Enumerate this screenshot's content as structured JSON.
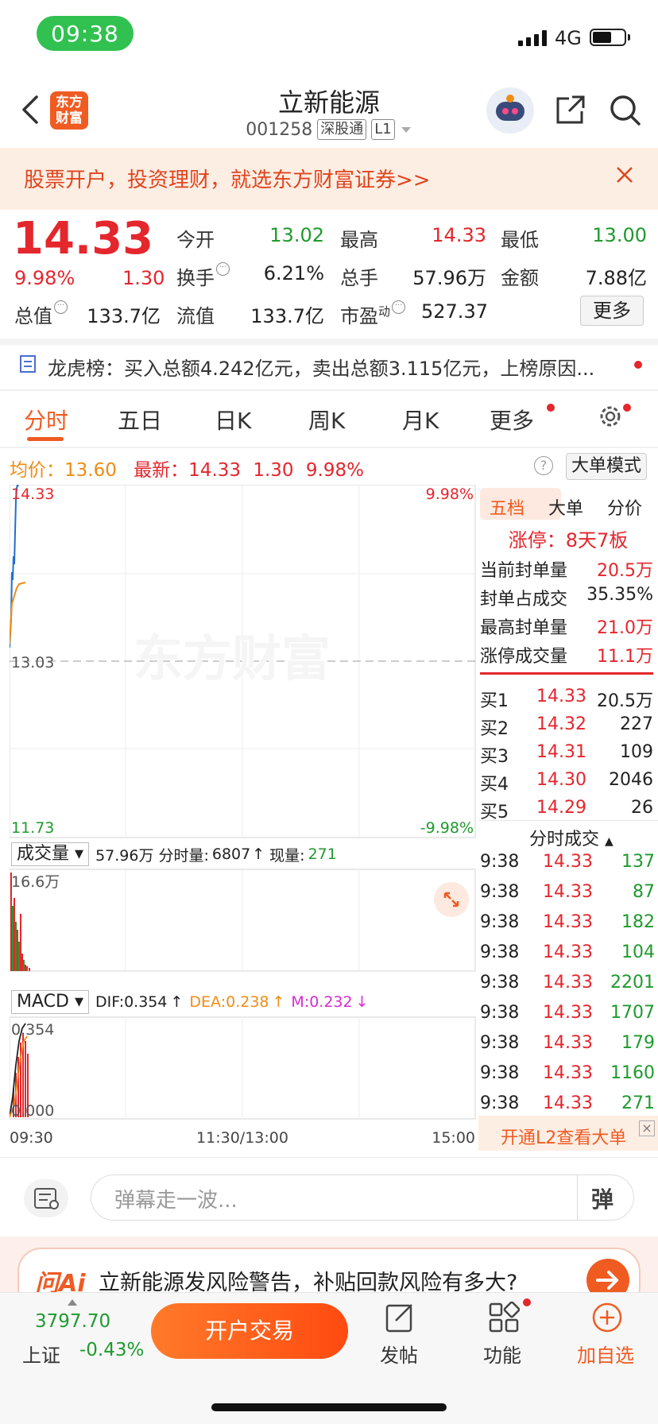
{
  "status": {
    "time": "09:38",
    "network": "4G"
  },
  "header": {
    "logo_text": "东方财富",
    "stock_name": "立新能源",
    "code": "001258",
    "tag1": "深股通",
    "tag2": "L1"
  },
  "banner": {
    "text": "股票开户，投资理财，就选东方财富证券>>"
  },
  "quote": {
    "price": "14.33",
    "pct": "9.98%",
    "chg": "1.30",
    "stats": [
      {
        "label": "今开",
        "value": "13.02",
        "color": "green"
      },
      {
        "label": "最高",
        "value": "14.33",
        "color": "red"
      },
      {
        "label": "最低",
        "value": "13.00",
        "color": "green"
      },
      {
        "label": "换手",
        "value": "6.21%",
        "color": "black"
      },
      {
        "label": "总手",
        "value": "57.96万",
        "color": "black"
      },
      {
        "label": "金额",
        "value": "7.88亿",
        "color": "black"
      },
      {
        "label": "总值",
        "value": "133.7亿",
        "color": "black"
      },
      {
        "label": "流值",
        "value": "133.7亿",
        "color": "black"
      },
      {
        "label": "市盈",
        "value": "527.37",
        "color": "black"
      }
    ],
    "pe_sup": "动",
    "more": "更多"
  },
  "dragon_tiger": {
    "text": "龙虎榜：买入总额4.242亿元，卖出总额3.115亿元，上榜原因..."
  },
  "tabs": [
    "分时",
    "五日",
    "日K",
    "周K",
    "月K",
    "更多"
  ],
  "avg_row": {
    "avg_label": "均价：",
    "avg_value": "13.60",
    "latest_label": "最新：",
    "latest_price": "14.33",
    "latest_chg": "1.30",
    "latest_pct": "9.98%",
    "help": "?",
    "big_mode": "大单模式"
  },
  "price_chart": {
    "top_left": "14.33",
    "top_right": "9.98%",
    "mid_left": "13.03",
    "bottom_left": "11.73",
    "bottom_right": "-9.98%",
    "watermark": "东方财富"
  },
  "volume": {
    "selector": "成交量",
    "total": "57.96万",
    "period_label": "分时量:",
    "period_value": "6807",
    "now_label": "现量:",
    "now_value": "271",
    "max_label": "16.6万"
  },
  "macd": {
    "selector": "MACD",
    "dif": "DIF:0.354",
    "dea": "DEA:0.238",
    "m": "M:0.232",
    "top_label": "0.354",
    "bottom_label": "0.000"
  },
  "time_axis": {
    "start": "09:30",
    "mid": "11:30/13:00",
    "end": "15:00"
  },
  "right_panel": {
    "tabs": [
      "五档",
      "大单",
      "分价"
    ],
    "limit_up": "涨停：8天7板",
    "seal": [
      {
        "label": "当前封单量",
        "value": "20.5万"
      },
      {
        "label": "封单占成交",
        "value": "35.35%"
      },
      {
        "label": "最高封单量",
        "value": "21.0万"
      },
      {
        "label": "涨停成交量",
        "value": "11.1万"
      }
    ],
    "bids": [
      {
        "label": "买1",
        "price": "14.33",
        "vol": "20.5万"
      },
      {
        "label": "买2",
        "price": "14.32",
        "vol": "227"
      },
      {
        "label": "买3",
        "price": "14.31",
        "vol": "109"
      },
      {
        "label": "买4",
        "price": "14.30",
        "vol": "2046"
      },
      {
        "label": "买5",
        "price": "14.29",
        "vol": "26"
      }
    ],
    "ticks_title": "分时成交",
    "ticks": [
      {
        "t": "9:38",
        "p": "14.33",
        "v": "137"
      },
      {
        "t": "9:38",
        "p": "14.33",
        "v": "87"
      },
      {
        "t": "9:38",
        "p": "14.33",
        "v": "182"
      },
      {
        "t": "9:38",
        "p": "14.33",
        "v": "104"
      },
      {
        "t": "9:38",
        "p": "14.33",
        "v": "2201"
      },
      {
        "t": "9:38",
        "p": "14.33",
        "v": "1707"
      },
      {
        "t": "9:38",
        "p": "14.33",
        "v": "179"
      },
      {
        "t": "9:38",
        "p": "14.33",
        "v": "1160"
      },
      {
        "t": "9:38",
        "p": "14.33",
        "v": "271"
      }
    ],
    "l2_text": "开通L2查看大单"
  },
  "danmaku": {
    "placeholder": "弹幕走一波...",
    "send": "弹"
  },
  "ai": {
    "logo": "问Ai",
    "text": "立新能源发风险警告，补贴回款风险有多大?"
  },
  "bottom": {
    "index_value": "3797.70",
    "index_name": "上证",
    "index_pct": "-0.43%",
    "trade": "开户交易",
    "post": "发帖",
    "func": "功能",
    "watch": "加自选"
  },
  "colors": {
    "accent": "#f05b22",
    "up": "#e4262d",
    "down": "#1f9a2e",
    "avg": "#f08c14",
    "price_line": "#1f6fd1",
    "macd": "#d82ad2"
  }
}
